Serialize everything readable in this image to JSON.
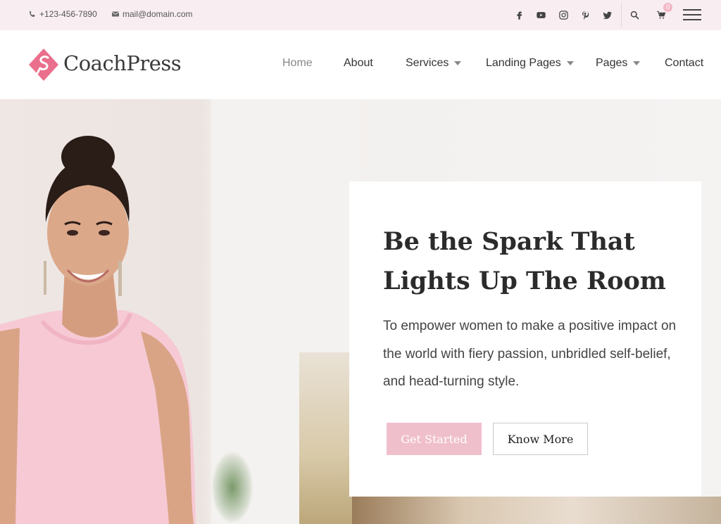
{
  "topbar": {
    "phone": "+123-456-7890",
    "email": "mail@domain.com",
    "social_icons": [
      "facebook-icon",
      "youtube-icon",
      "instagram-icon",
      "pinterest-icon",
      "twitter-icon"
    ],
    "cart_count": "0"
  },
  "header": {
    "logo_text": "CoachPress",
    "nav": {
      "home": "Home",
      "about": "About",
      "services": "Services",
      "landing_pages": "Landing Pages",
      "pages": "Pages",
      "contact": "Contact"
    }
  },
  "hero": {
    "title": "Be the Spark That Lights Up The Room",
    "description": "To empower women to make a positive impact on the world with fiery passion, unbridled self-belief, and head-turning style.",
    "primary_button": "Get Started",
    "secondary_button": "Know More"
  },
  "colors": {
    "accent": "#f0bfcc",
    "logo": "#ea6f8d",
    "topbar_bg": "#f8eef2"
  }
}
